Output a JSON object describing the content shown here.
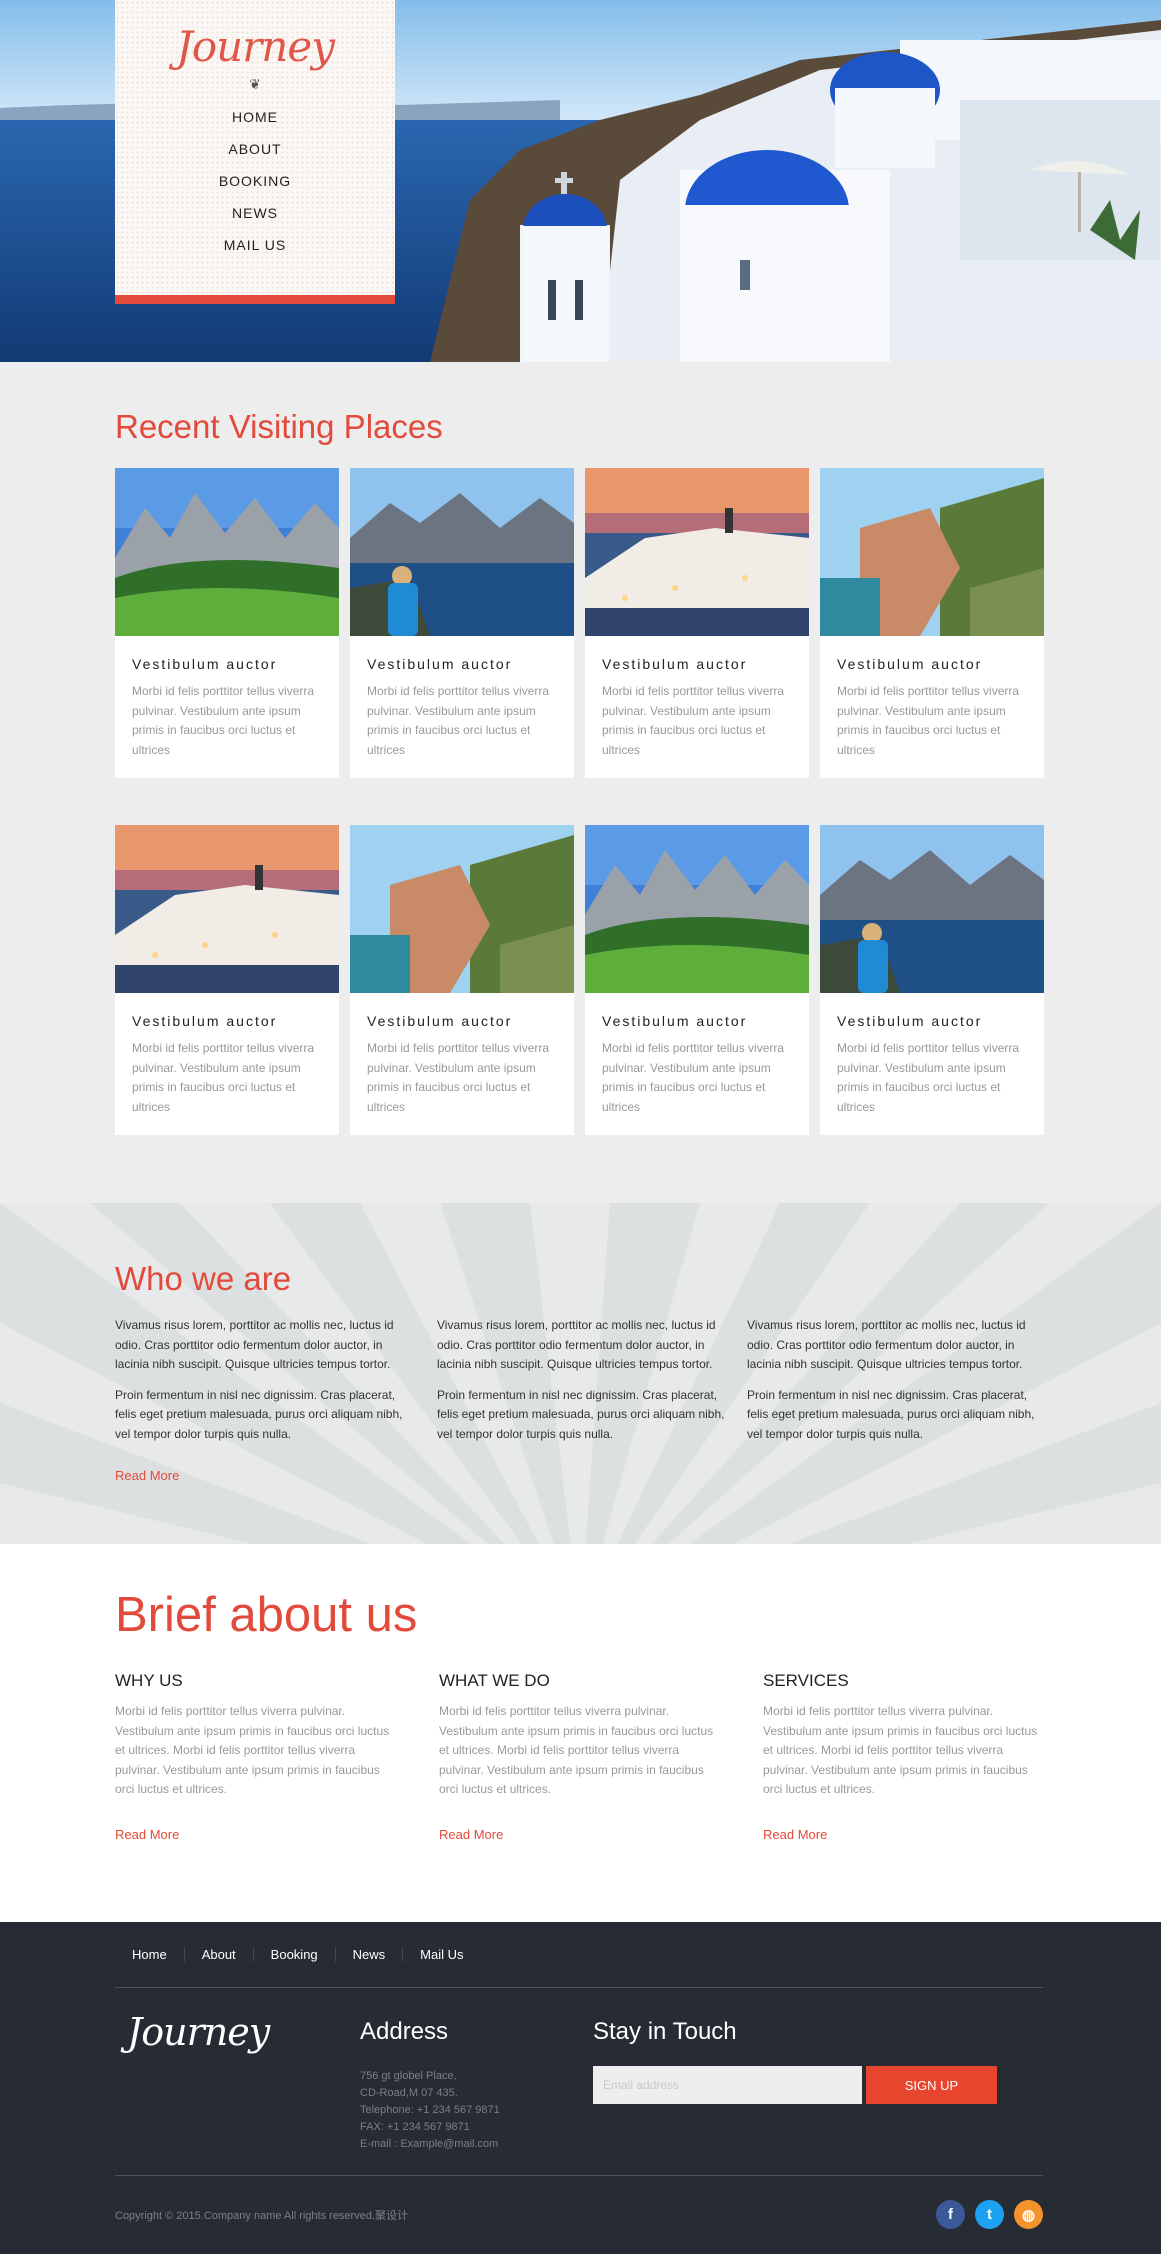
{
  "brand": {
    "logo_text": "Journey",
    "ornament": "❦"
  },
  "nav": {
    "items": [
      {
        "label": "HOME"
      },
      {
        "label": "ABOUT"
      },
      {
        "label": "BOOKING"
      },
      {
        "label": "NEWS"
      },
      {
        "label": "MAIL US"
      }
    ]
  },
  "recent": {
    "title": "Recent Visiting Places",
    "cards": [
      {
        "title": "Vestibulum auctor",
        "text": "Morbi id felis porttitor tellus viverra pulvinar. Vestibulum ante ipsum primis in faucibus orci luctus et ultrices",
        "image": "alpine-meadow"
      },
      {
        "title": "Vestibulum auctor",
        "text": "Morbi id felis porttitor tellus viverra pulvinar. Vestibulum ante ipsum primis in faucibus orci luctus et ultrices",
        "image": "fjord-hiker"
      },
      {
        "title": "Vestibulum auctor",
        "text": "Morbi id felis porttitor tellus viverra pulvinar. Vestibulum ante ipsum primis in faucibus orci luctus et ultrices",
        "image": "santorini-dusk"
      },
      {
        "title": "Vestibulum auctor",
        "text": "Morbi id felis porttitor tellus viverra pulvinar. Vestibulum ante ipsum primis in faucibus orci luctus et ultrices",
        "image": "cliff-village"
      },
      {
        "title": "Vestibulum auctor",
        "text": "Morbi id felis porttitor tellus viverra pulvinar. Vestibulum ante ipsum primis in faucibus orci luctus et ultrices",
        "image": "santorini-dusk"
      },
      {
        "title": "Vestibulum auctor",
        "text": "Morbi id felis porttitor tellus viverra pulvinar. Vestibulum ante ipsum primis in faucibus orci luctus et ultrices",
        "image": "cliff-village"
      },
      {
        "title": "Vestibulum auctor",
        "text": "Morbi id felis porttitor tellus viverra pulvinar. Vestibulum ante ipsum primis in faucibus orci luctus et ultrices",
        "image": "alpine-meadow"
      },
      {
        "title": "Vestibulum auctor",
        "text": "Morbi id felis porttitor tellus viverra pulvinar. Vestibulum ante ipsum primis in faucibus orci luctus et ultrices",
        "image": "fjord-hiker"
      }
    ]
  },
  "who": {
    "title": "Who we are",
    "columns": [
      {
        "p1": "Vivamus risus lorem, porttitor ac mollis nec, luctus id odio. Cras porttitor odio fermentum dolor auctor, in lacinia nibh suscipit. Quisque ultricies tempus tortor.",
        "p2": "Proin fermentum in nisl nec dignissim. Cras placerat, felis eget pretium malesuada, purus orci aliquam nibh, vel tempor dolor turpis quis nulla."
      },
      {
        "p1": "Vivamus risus lorem, porttitor ac mollis nec, luctus id odio. Cras porttitor odio fermentum dolor auctor, in lacinia nibh suscipit. Quisque ultricies tempus tortor.",
        "p2": "Proin fermentum in nisl nec dignissim. Cras placerat, felis eget pretium malesuada, purus orci aliquam nibh, vel tempor dolor turpis quis nulla."
      },
      {
        "p1": "Vivamus risus lorem, porttitor ac mollis nec, luctus id odio. Cras porttitor odio fermentum dolor auctor, in lacinia nibh suscipit. Quisque ultricies tempus tortor.",
        "p2": "Proin fermentum in nisl nec dignissim. Cras placerat, felis eget pretium malesuada, purus orci aliquam nibh, vel tempor dolor turpis quis nulla."
      }
    ],
    "read_more": "Read More"
  },
  "brief": {
    "title": "Brief about us",
    "columns": [
      {
        "heading": "WHY US",
        "text": "Morbi id felis porttitor tellus viverra pulvinar. Vestibulum ante ipsum primis in faucibus orci luctus et ultrices. Morbi id felis porttitor tellus viverra pulvinar. Vestibulum ante ipsum primis in faucibus orci luctus et ultrices.",
        "read_more": "Read More"
      },
      {
        "heading": "WHAT WE DO",
        "text": "Morbi id felis porttitor tellus viverra pulvinar. Vestibulum ante ipsum primis in faucibus orci luctus et ultrices. Morbi id felis porttitor tellus viverra pulvinar. Vestibulum ante ipsum primis in faucibus orci luctus et ultrices.",
        "read_more": "Read More"
      },
      {
        "heading": "SERVICES",
        "text": "Morbi id felis porttitor tellus viverra pulvinar. Vestibulum ante ipsum primis in faucibus orci luctus et ultrices. Morbi id felis porttitor tellus viverra pulvinar. Vestibulum ante ipsum primis in faucibus orci luctus et ultrices.",
        "read_more": "Read More"
      }
    ]
  },
  "footer": {
    "nav": [
      "Home",
      "About",
      "Booking",
      "News",
      "Mail Us"
    ],
    "logo_text": "Journey",
    "address": {
      "title": "Address",
      "lines": [
        "756 gt globel Place,",
        "CD-Road,M 07 435.",
        "Telephone: +1 234 567 9871",
        "FAX: +1 234 567 9871",
        "E-mail : Example@mail.com"
      ]
    },
    "touch": {
      "title": "Stay in Touch",
      "placeholder": "Email address",
      "button": "SIGN UP"
    },
    "copyright": "Copyright © 2015.Company name All rights reserved.聚设计",
    "social": [
      {
        "icon": "facebook-icon",
        "glyph": "f",
        "color": "#3b5998"
      },
      {
        "icon": "twitter-icon",
        "glyph": "t",
        "color": "#1da1f2"
      },
      {
        "icon": "dribbble-icon",
        "glyph": "◍",
        "color": "#f4922b"
      }
    ]
  },
  "colors": {
    "accent": "#e24a3b",
    "footer_bg": "#262b34",
    "section_bg": "#eeeded"
  }
}
